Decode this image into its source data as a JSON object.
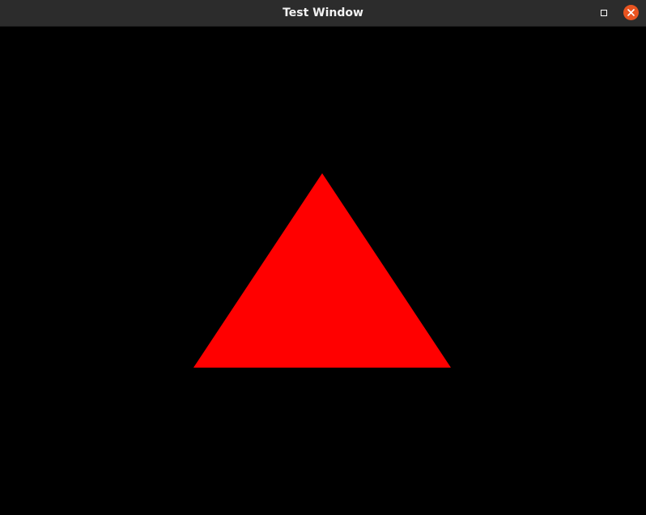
{
  "window": {
    "title": "Test Window",
    "controls": {
      "maximize_icon": "maximize-icon",
      "close_icon": "close-icon",
      "close_color": "#e95420"
    }
  },
  "scene": {
    "background_color": "#000000",
    "shape": {
      "type": "triangle",
      "fill_color": "#ff0000"
    }
  }
}
